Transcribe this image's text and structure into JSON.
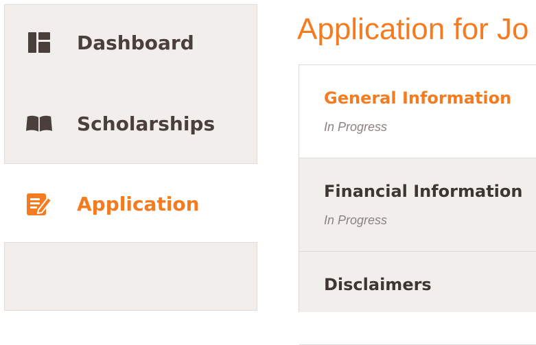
{
  "sidebar": {
    "items": [
      {
        "label": "Dashboard",
        "icon": "dashboard-icon"
      },
      {
        "label": "Scholarships",
        "icon": "book-icon"
      },
      {
        "label": "Application",
        "icon": "edit-icon",
        "active": true
      }
    ]
  },
  "main": {
    "title": "Application for Jo",
    "steps": [
      {
        "title": "General Information",
        "status": "In Progress",
        "active": true
      },
      {
        "title": "Financial Information",
        "status": "In Progress"
      },
      {
        "title": "Disclaimers",
        "status": ""
      }
    ]
  },
  "colors": {
    "accent": "#f47b20",
    "text_dark": "#4a3f3a",
    "panel_bg": "#f1eeec",
    "border": "#dedad7"
  }
}
